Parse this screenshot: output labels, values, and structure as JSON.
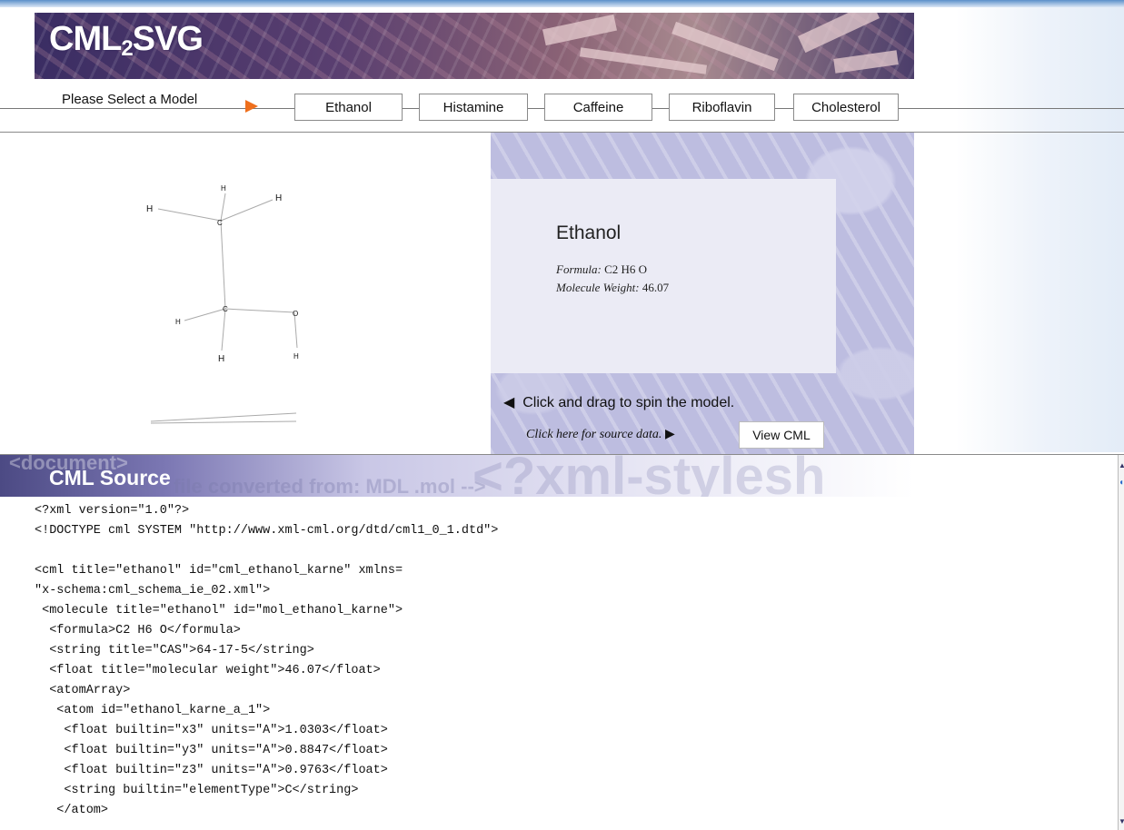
{
  "header": {
    "logo_main": "CML",
    "logo_sub": "2",
    "logo_tail": "SVG"
  },
  "nav": {
    "prompt": "Please Select a Model",
    "models": [
      "Ethanol",
      "Histamine",
      "Caffeine",
      "Riboflavin",
      "Cholesterol"
    ]
  },
  "molecule": {
    "atoms": {
      "h1": "H",
      "h2": "H",
      "h3": "H",
      "c1": "C",
      "c2": "C",
      "h4": "H",
      "o": "O",
      "h5": "H",
      "h6": "H"
    }
  },
  "info": {
    "name": "Ethanol",
    "formula_label": "Formula:",
    "formula_value": "C2 H6 O",
    "weight_label": "Molecule Weight:",
    "weight_value": "46.07",
    "spin_hint": "Click and drag to spin the model.",
    "source_prompt": "Click here for source data.",
    "view_cml_label": "View CML"
  },
  "source": {
    "title": "CML Source",
    "ghost_text": "<document>",
    "ghost_text_2": "<!-- file converted from: MDL .mol -->",
    "ghost_text_3": "<?xml-stylesh",
    "lines": [
      "<?xml version=\"1.0\"?>",
      "<!DOCTYPE cml SYSTEM \"http://www.xml-cml.org/dtd/cml1_0_1.dtd\">",
      "",
      "<cml title=\"ethanol\" id=\"cml_ethanol_karne\" xmlns=",
      "\"x-schema:cml_schema_ie_02.xml\">",
      " <molecule title=\"ethanol\" id=\"mol_ethanol_karne\">",
      "  <formula>C2 H6 O</formula>",
      "  <string title=\"CAS\">64-17-5</string>",
      "  <float title=\"molecular weight\">46.07</float>",
      "  <atomArray>",
      "   <atom id=\"ethanol_karne_a_1\">",
      "    <float builtin=\"x3\" units=\"A\">1.0303</float>",
      "    <float builtin=\"y3\" units=\"A\">0.8847</float>",
      "    <float builtin=\"z3\" units=\"A\">0.9763</float>",
      "    <string builtin=\"elementType\">C</string>",
      "   </atom>"
    ]
  },
  "colors": {
    "accent_arrow": "#ef6f1c",
    "panel_lavender": "#bdbde0",
    "banner_purple": "#3a2d63"
  }
}
